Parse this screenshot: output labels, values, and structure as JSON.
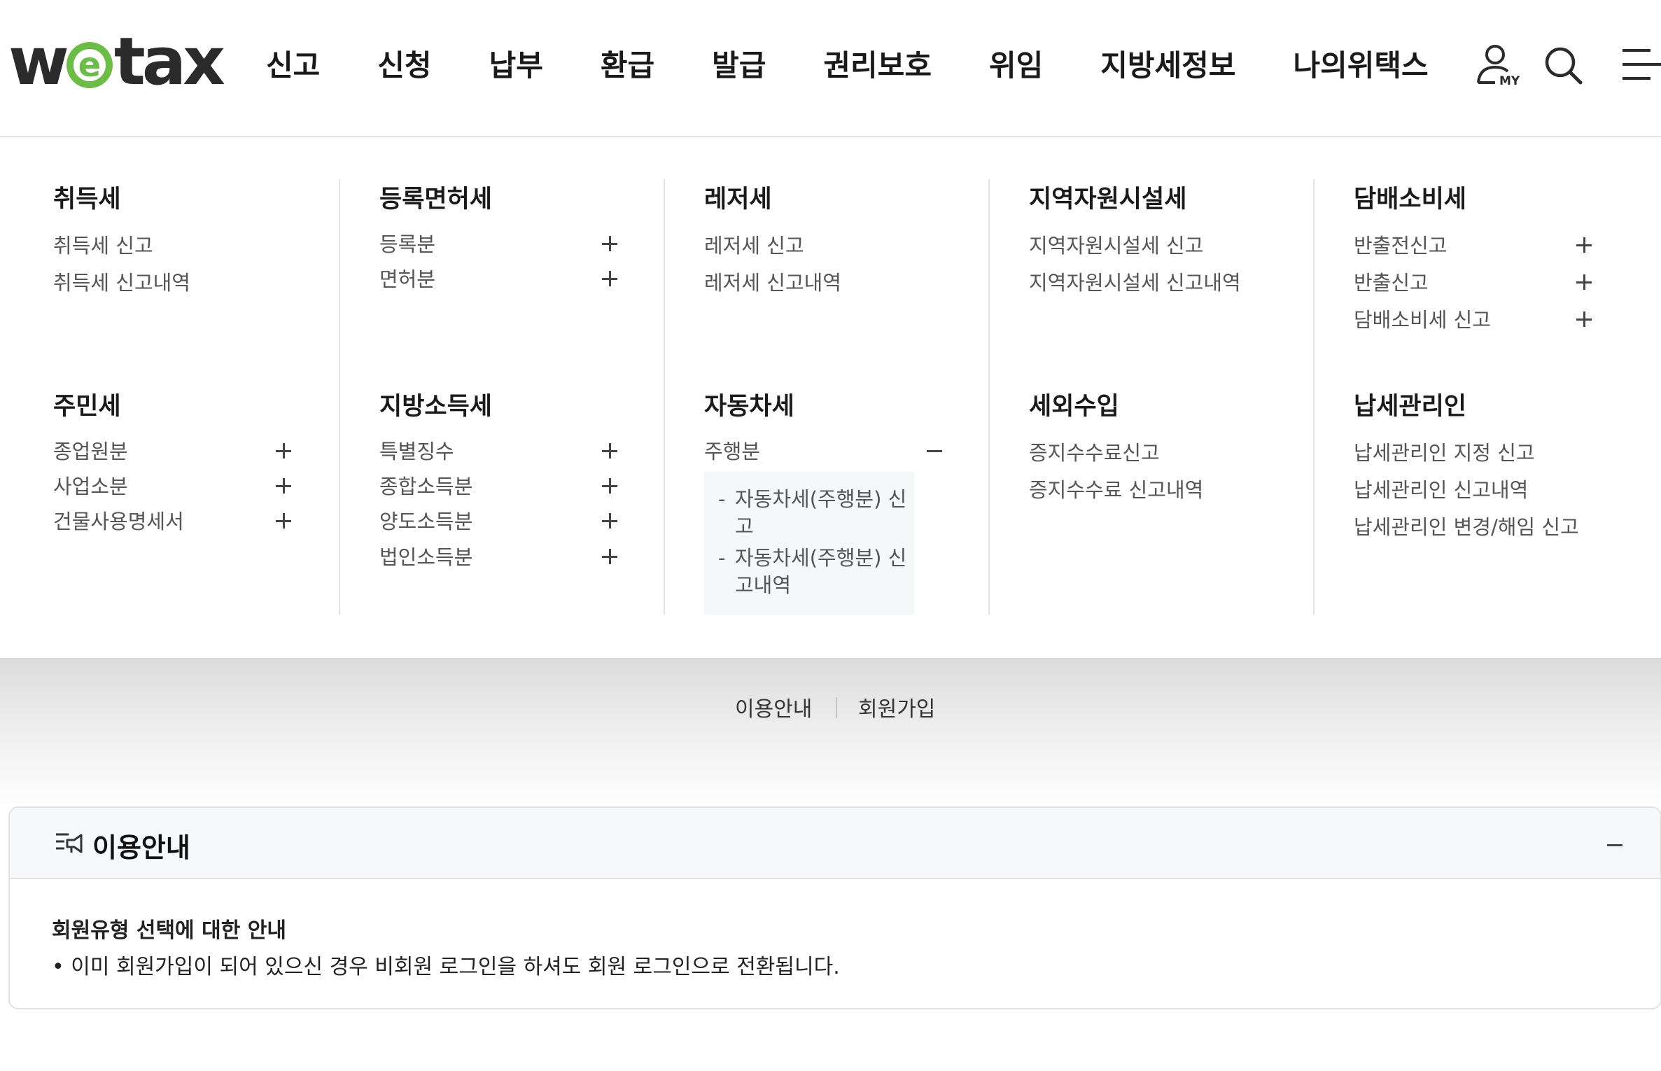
{
  "header": {
    "logo": "wetax",
    "nav": [
      "신고",
      "신청",
      "납부",
      "환급",
      "발급",
      "권리보호",
      "위임",
      "지방세정보",
      "나의위택스"
    ],
    "icons": {
      "my": "MY",
      "search": "search-icon",
      "menu": "menu-icon"
    }
  },
  "menu": {
    "acquisition": {
      "title": "취득세",
      "items": [
        "취득세 신고",
        "취득세 신고내역"
      ]
    },
    "registration": {
      "title": "등록면허세",
      "items": [
        "등록분",
        "면허분"
      ]
    },
    "leisure": {
      "title": "레저세",
      "items": [
        "레저세 신고",
        "레저세 신고내역"
      ]
    },
    "regional": {
      "title": "지역자원시설세",
      "items": [
        "지역자원시설세 신고",
        "지역자원시설세 신고내역"
      ]
    },
    "tobacco": {
      "title": "담배소비세",
      "items": [
        "반출전신고",
        "반출신고",
        "담배소비세 신고"
      ]
    },
    "resident": {
      "title": "주민세",
      "items": [
        "종업원분",
        "사업소분",
        "건물사용명세서"
      ]
    },
    "income": {
      "title": "지방소득세",
      "items": [
        "특별징수",
        "종합소득분",
        "양도소득분",
        "법인소득분"
      ]
    },
    "car": {
      "title": "자동차세",
      "items": [
        "주행분"
      ],
      "sub": [
        {
          "l1": "자동차세(주행분) 신",
          "l2": "고"
        },
        {
          "l1": "자동차세(주행분) 신",
          "l2": "고내역"
        }
      ]
    },
    "nontax": {
      "title": "세외수입",
      "items": [
        "증지수수료신고",
        "증지수수료 신고내역"
      ]
    },
    "taxagent": {
      "title": "납세관리인",
      "items": [
        "납세관리인 지정 신고",
        "납세관리인 신고내역",
        "납세관리인 변경/해임 신고"
      ]
    }
  },
  "band": {
    "links": [
      "이용안내",
      "회원가입"
    ]
  },
  "panel": {
    "title": "이용안내",
    "heading": "회원유형 선택에 대한 안내",
    "text": "• 이미 회원가입이 되어 있으신 경우 비회원 로그인을 하셔도 회원 로그인으로 전환됩니다."
  },
  "colors": {
    "logo_e": "#6cbd45",
    "text": "#222222",
    "muted": "#555555"
  }
}
